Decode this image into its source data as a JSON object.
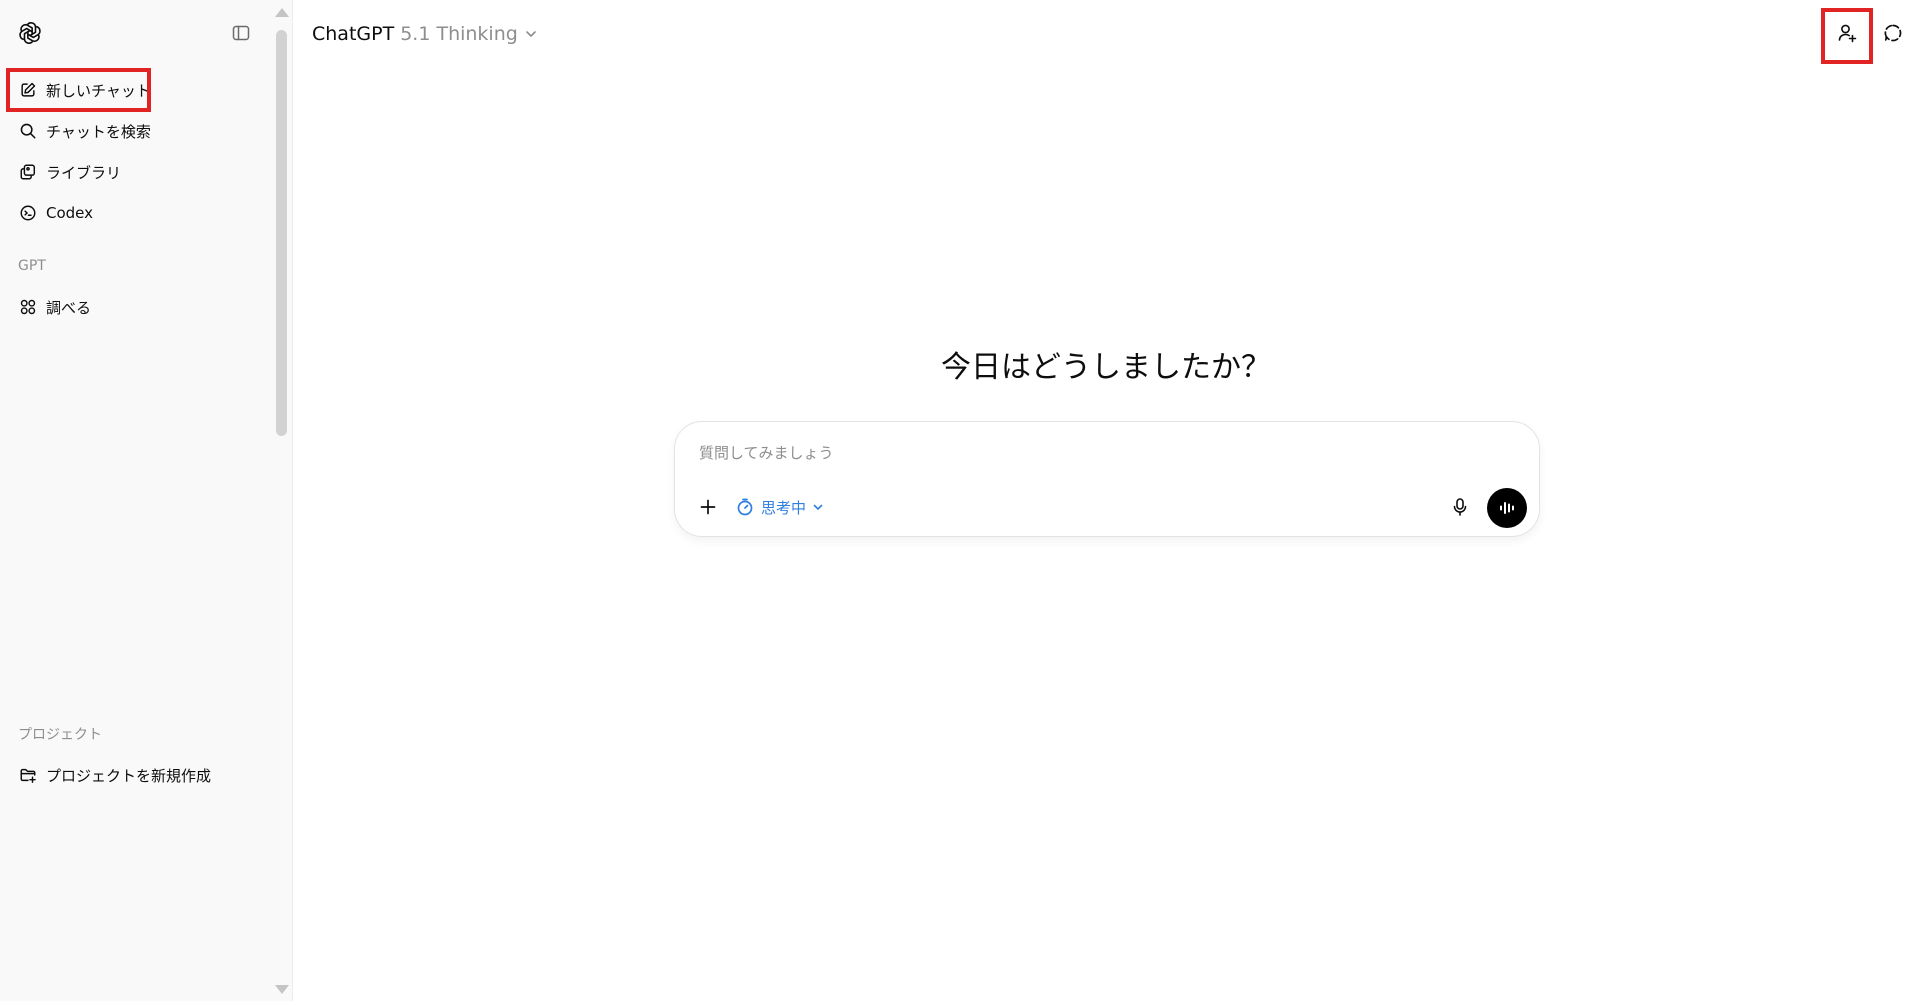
{
  "sidebar": {
    "logo_icon": "openai-logo-icon",
    "toggle_icon": "sidebar-toggle-icon",
    "items": [
      {
        "label": "新しいチャット",
        "icon": "new-chat-icon"
      },
      {
        "label": "チャットを検索",
        "icon": "search-icon"
      },
      {
        "label": "ライブラリ",
        "icon": "library-icon"
      },
      {
        "label": "Codex",
        "icon": "codex-icon"
      }
    ],
    "gpt_section": {
      "title": "GPT",
      "items": [
        {
          "label": "調べる",
          "icon": "explore-gpts-icon"
        }
      ]
    },
    "project_section": {
      "title": "プロジェクト",
      "items": [
        {
          "label": "プロジェクトを新規作成",
          "icon": "new-project-folder-icon"
        }
      ]
    }
  },
  "header": {
    "brand": "ChatGPT",
    "model": "5.1 Thinking",
    "share_icon": "add-person-icon",
    "temp_chat_icon": "temporary-chat-icon"
  },
  "main": {
    "headline": "今日はどうしましたか？",
    "composer": {
      "placeholder": "質問してみましょう",
      "value": "",
      "thinking_label": "思考中",
      "plus_icon": "plus-icon",
      "timer_icon": "timer-icon",
      "mic_icon": "microphone-icon",
      "voice_icon": "voice-mode-icon"
    }
  },
  "annotations": {
    "highlight_color": "#e02424"
  },
  "colors": {
    "accent_blue": "#2f7fe0",
    "sidebar_bg": "#f9f9f9",
    "text": "#0d0d0d",
    "muted": "#8e8e8e"
  }
}
